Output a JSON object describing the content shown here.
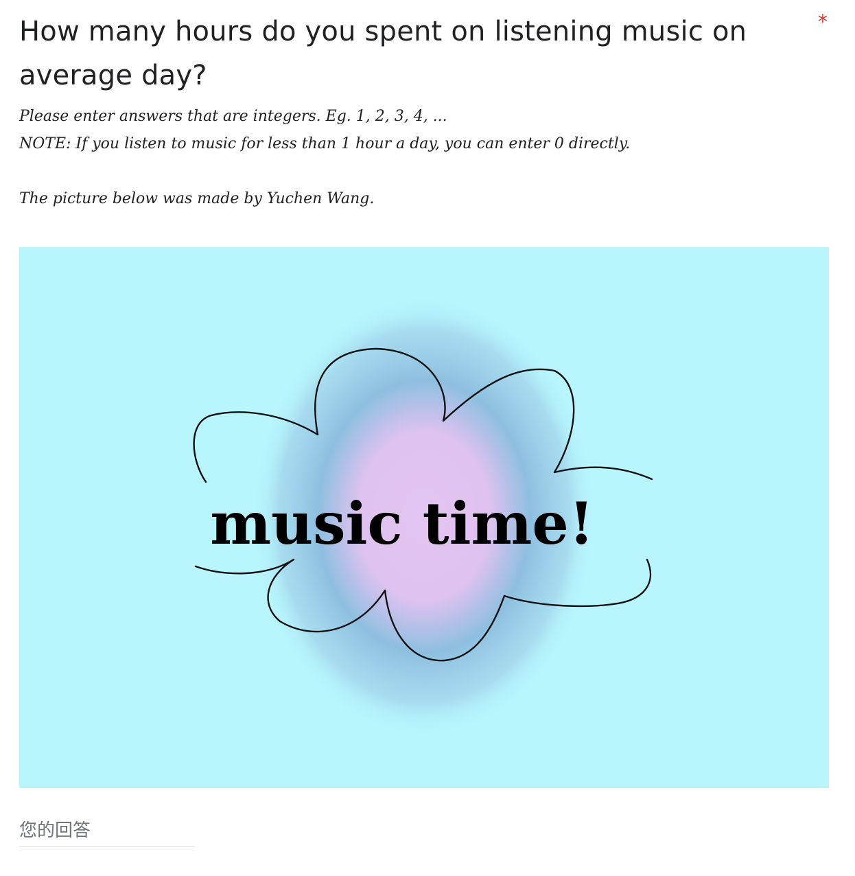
{
  "question": {
    "title": "How many hours do you spent on listening music on average day?",
    "required_marker": "*",
    "required_color": "#d93025",
    "description_lines": [
      "Please enter answers that are integers. Eg. 1, 2, 3, 4, ...",
      "NOTE: If you listen to music for less than 1 hour a day, you can enter 0 directly.",
      "",
      "The picture below was made by Yuchen Wang."
    ]
  },
  "picture": {
    "text": "music time!",
    "background_color": "#b8f5fd",
    "glow_inner_color": "#e3c4f0",
    "glow_outer_color": "#8ebfe0"
  },
  "answer": {
    "placeholder": "您的回答",
    "value": ""
  }
}
